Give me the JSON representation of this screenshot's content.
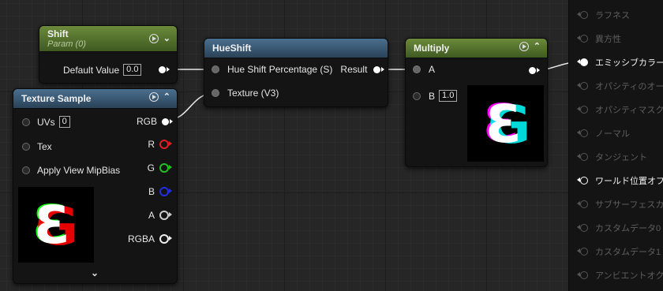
{
  "nodes": {
    "shift": {
      "title": "Shift",
      "subtitle": "Param (0)",
      "default_value_label": "Default Value",
      "default_value": "0.0"
    },
    "hueshift": {
      "title": "HueShift",
      "inputs": [
        "Hue Shift Percentage (S)",
        "Texture (V3)"
      ],
      "output": "Result"
    },
    "multiply": {
      "title": "Multiply",
      "input_a": "A",
      "input_b": "B",
      "b_value": "1.0"
    },
    "texture_sample": {
      "title": "Texture Sample",
      "inputs": [
        {
          "label": "UVs",
          "value": "0"
        },
        {
          "label": "Tex"
        },
        {
          "label": "Apply View MipBias"
        }
      ],
      "outputs": [
        {
          "label": "RGB",
          "color": "#ffffff"
        },
        {
          "label": "R",
          "color": "#e02020"
        },
        {
          "label": "G",
          "color": "#20c020"
        },
        {
          "label": "B",
          "color": "#2030e0"
        },
        {
          "label": "A",
          "color": "#cccccc"
        },
        {
          "label": "RGBA",
          "color": "#eeeeee"
        }
      ]
    }
  },
  "sidebar": {
    "items": [
      {
        "label": "ラフネス",
        "active": false
      },
      {
        "label": "異方性",
        "active": false
      },
      {
        "label": "エミッシブカラー",
        "active": true
      },
      {
        "label": "オパシティのオー",
        "active": false
      },
      {
        "label": "オパシティマスク",
        "active": false
      },
      {
        "label": "ノーマル",
        "active": false
      },
      {
        "label": "タンジェント",
        "active": false
      },
      {
        "label": "ワールド位置オフ",
        "active": true
      },
      {
        "label": "サブサーフェスカ",
        "active": false
      },
      {
        "label": "カスタムデータ0",
        "active": false
      },
      {
        "label": "カスタムデータ1",
        "active": false
      },
      {
        "label": "アンビエントオク",
        "active": false
      }
    ]
  },
  "colors": {
    "param_header": "#5f7d34",
    "function_header": "#3e5f7c",
    "multiply_header": "#5f7d34"
  }
}
